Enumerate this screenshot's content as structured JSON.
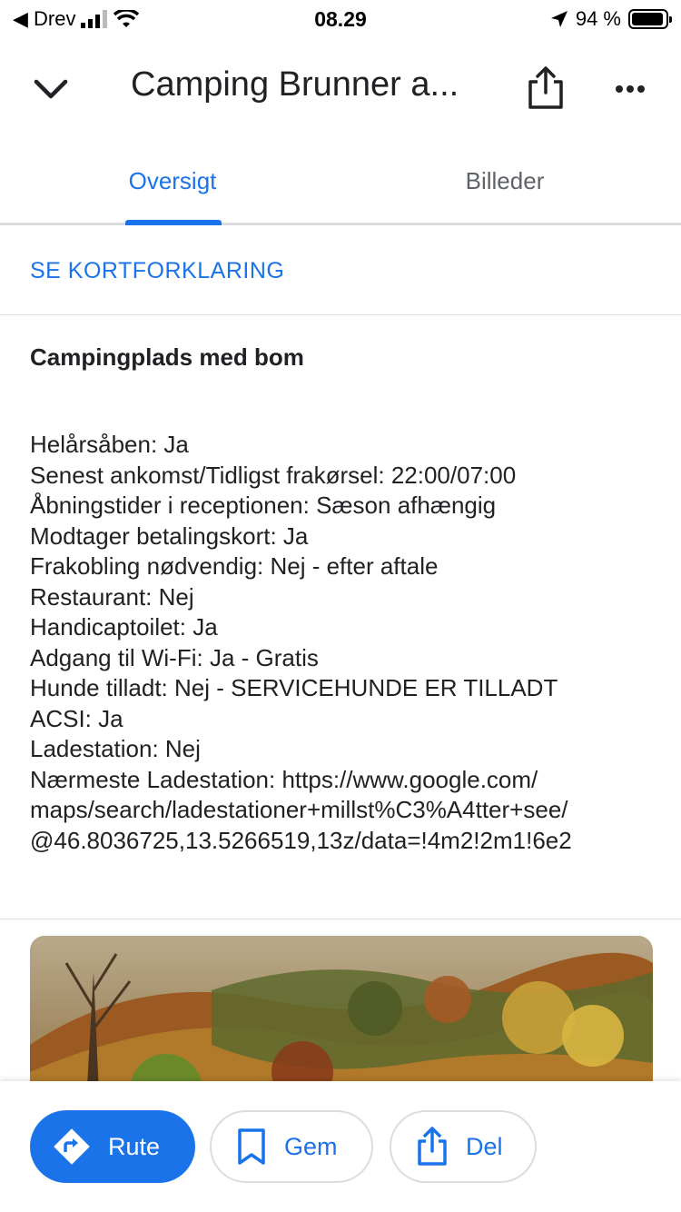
{
  "status_bar": {
    "carrier": "◀ Drev",
    "time": "08.29",
    "battery": "94 %",
    "battery_level": 0.94
  },
  "header": {
    "title": "Camping Brunner a..."
  },
  "tabs": [
    {
      "label": "Oversigt",
      "active": true
    },
    {
      "label": "Billeder",
      "active": false
    }
  ],
  "legend_link": "SE KORTFORKLARING",
  "description": {
    "heading": "Campingplads med bom",
    "lines": [
      "Helårsåben: Ja",
      "Senest ankomst/Tidligst frakørsel: 22:00/07:00",
      "Åbningstider i receptionen: Sæson afhængig",
      "Modtager betalingskort: Ja",
      "Frakobling nødvendig: Nej - efter aftale",
      "Restaurant: Nej",
      "Handicaptoilet: Ja",
      "Adgang til Wi-Fi: Ja - Gratis",
      "Hunde tilladt: Nej - SERVICEHUNDE ER TILLADT",
      "ACSI: Ja",
      "Ladestation: Nej",
      "Nærmeste Ladestation: https://www.google.com/",
      "maps/search/ladestationer+millst%C3%A4tter+see/",
      "@46.8036725,13.5266519,13z/data=!4m2!2m1!6e2"
    ]
  },
  "actions": {
    "route": "Rute",
    "save": "Gem",
    "share": "Del"
  },
  "colors": {
    "accent": "#1a73e8",
    "text": "#202124",
    "muted": "#5f6368",
    "divider": "#dadce0"
  },
  "icons": [
    "back-arrow-icon",
    "signal-icon",
    "wifi-icon",
    "location-arrow-icon",
    "battery-icon",
    "chevron-down-icon",
    "share-icon",
    "more-icon",
    "directions-icon",
    "bookmark-icon"
  ]
}
